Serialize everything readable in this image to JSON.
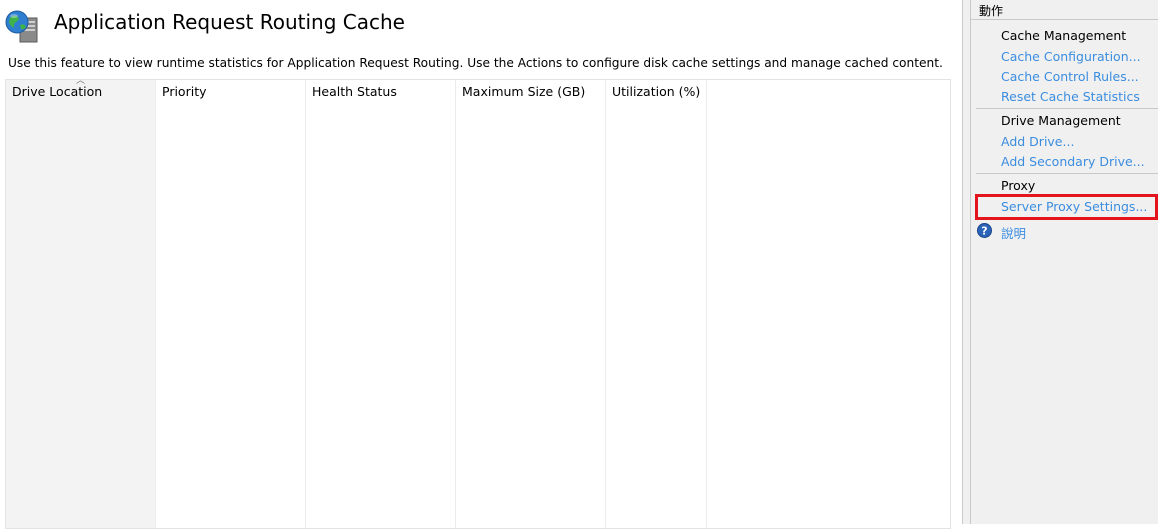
{
  "header": {
    "title": "Application Request Routing Cache",
    "description": "Use this feature to view runtime statistics for Application Request Routing.  Use the Actions to configure disk cache settings and manage cached content."
  },
  "table": {
    "columns": [
      {
        "label": "Drive Location",
        "sorted": true
      },
      {
        "label": "Priority"
      },
      {
        "label": "Health Status"
      },
      {
        "label": "Maximum Size (GB)"
      },
      {
        "label": "Utilization (%)"
      }
    ],
    "rows": []
  },
  "actions": {
    "header": "動作",
    "groups": [
      {
        "title": "Cache Management",
        "items": [
          "Cache Configuration...",
          "Cache Control Rules...",
          "Reset Cache Statistics"
        ]
      },
      {
        "title": "Drive Management",
        "items": [
          "Add Drive...",
          "Add Secondary Drive..."
        ]
      },
      {
        "title": "Proxy",
        "items": [
          "Server Proxy Settings..."
        ]
      }
    ],
    "help": "說明"
  },
  "colors": {
    "link": "#3b8de0",
    "highlight_border": "#e3141c",
    "panel_bg": "#f0f0f0"
  },
  "icons": {
    "header": "globe-server-icon",
    "help": "help-icon",
    "sort": "sort-ascending-icon"
  }
}
